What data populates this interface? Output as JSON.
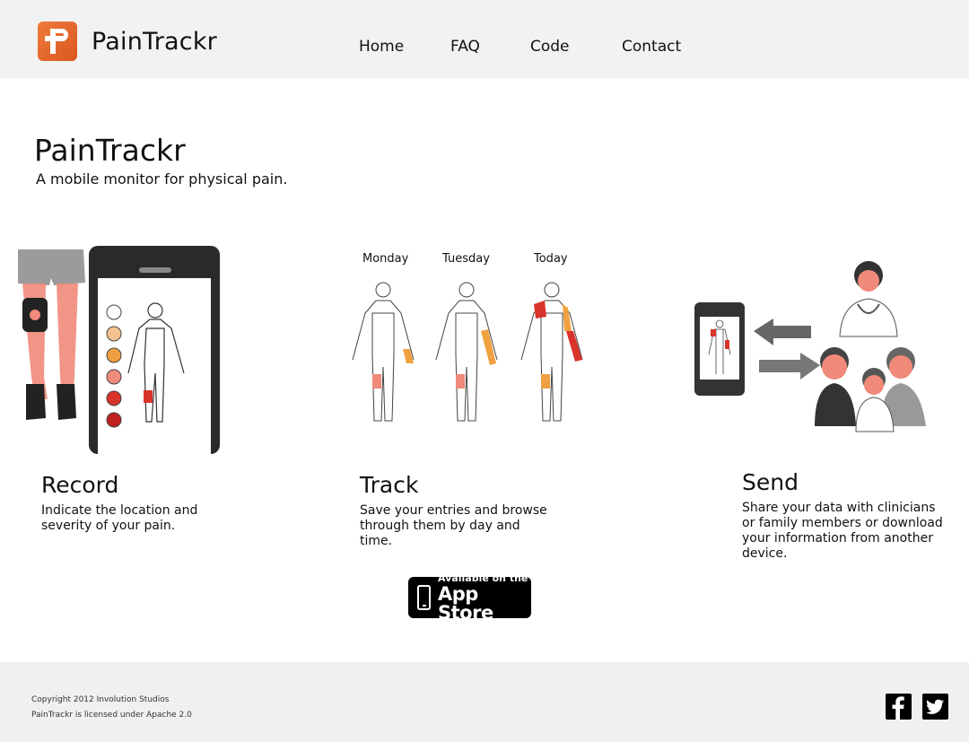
{
  "header": {
    "brand": "PainTrackr",
    "nav": [
      {
        "label": "Home"
      },
      {
        "label": "FAQ"
      },
      {
        "label": "Code"
      },
      {
        "label": "Contact"
      }
    ]
  },
  "hero": {
    "title": "PainTrackr",
    "subtitle": "A mobile monitor for physical pain."
  },
  "track_illustration": {
    "days": [
      "Monday",
      "Tuesday",
      "Today"
    ]
  },
  "features": [
    {
      "title": "Record",
      "text": "Indicate the location and severity of your pain."
    },
    {
      "title": "Track",
      "text": "Save your entries and browse through them by day and time."
    },
    {
      "title": "Send",
      "text": "Share your data with clinicians or family members or download your information from another device."
    }
  ],
  "appstore": {
    "line1": "Available on the",
    "line2": "App Store"
  },
  "footer": {
    "copyright": "Copyright 2012 Involution Studios",
    "license": "PainTrackr is licensed under Apache 2.0"
  },
  "icons": {
    "facebook": "facebook-icon",
    "twitter": "twitter-icon"
  },
  "colors": {
    "brand_orange": "#e2642a",
    "header_bg": "#f2f2f2",
    "footer_bg": "#f0f0f0",
    "pain_red": "#d9342b",
    "pain_orange": "#f0a040",
    "pain_pink": "#f08a7a"
  }
}
